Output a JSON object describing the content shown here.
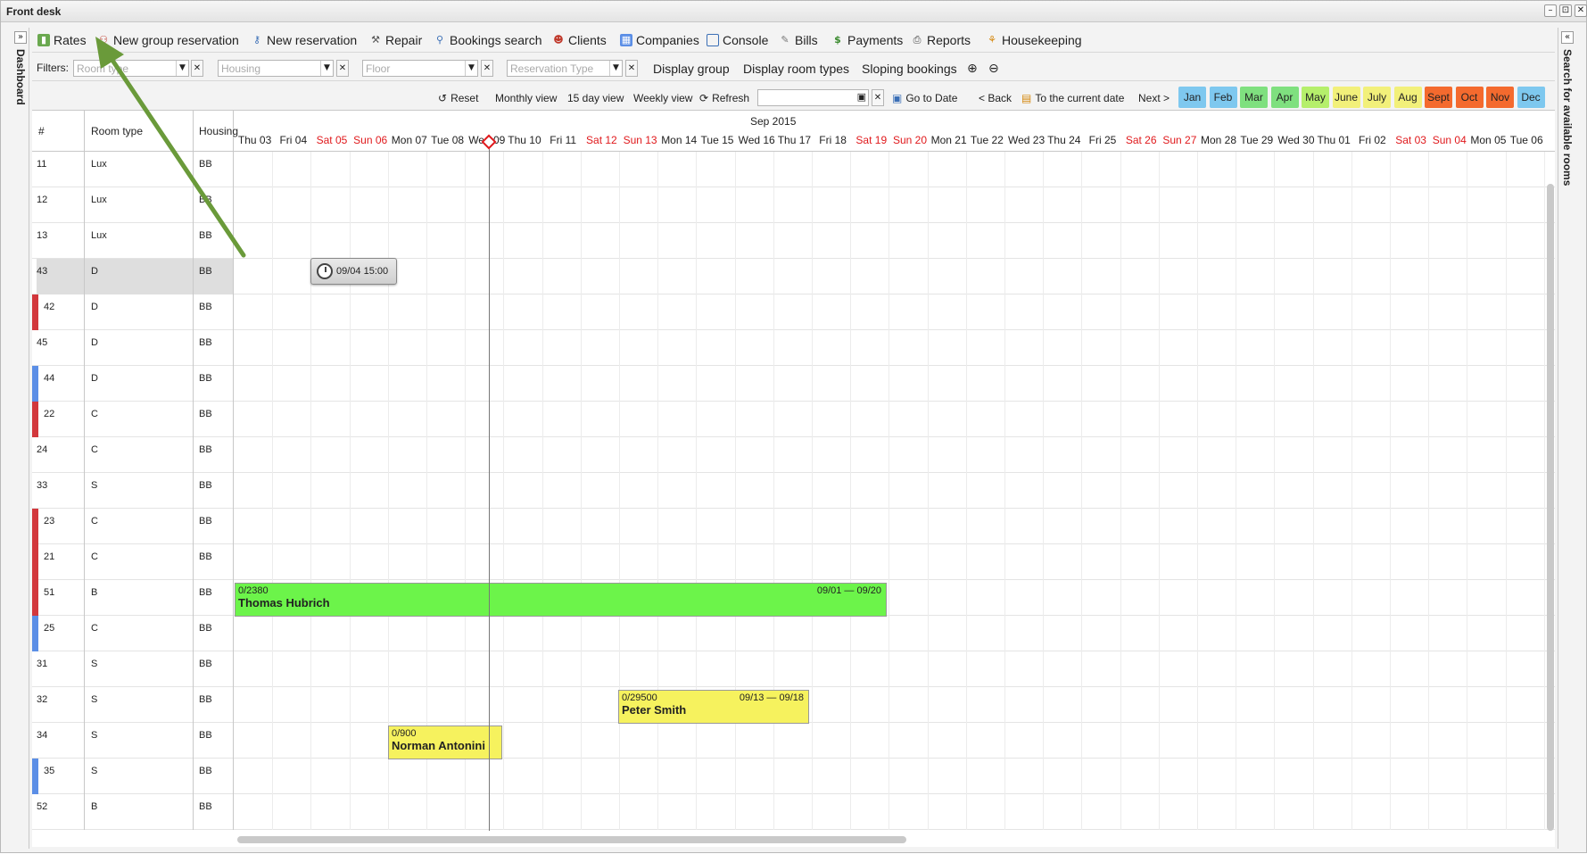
{
  "window": {
    "title": "Front desk",
    "controls": [
      "–",
      "⊡",
      "✕"
    ]
  },
  "sidebars": {
    "left_label": "Dashboard",
    "right_label": "Search for available rooms",
    "left_toggle": "»",
    "right_toggle": "«"
  },
  "menu": [
    {
      "label": "Rates",
      "icon": "bar-chart-icon"
    },
    {
      "label": "New group reservation",
      "icon": "group-icon"
    },
    {
      "label": "New reservation",
      "icon": "key-icon"
    },
    {
      "label": "Repair",
      "icon": "wrench-icon"
    },
    {
      "label": "Bookings search",
      "icon": "search-icon"
    },
    {
      "label": "Clients",
      "icon": "users-icon"
    },
    {
      "label": "Companies",
      "icon": "building-icon"
    },
    {
      "label": "Console",
      "icon": "window-icon"
    },
    {
      "label": "Bills",
      "icon": "notepad-icon"
    },
    {
      "label": "Payments",
      "icon": "dollar-icon"
    },
    {
      "label": "Reports",
      "icon": "printer-icon"
    },
    {
      "label": "Housekeeping",
      "icon": "broom-icon"
    }
  ],
  "filters": {
    "label": "Filters:",
    "room_type_placeholder": "Room type",
    "housing_placeholder": "Housing",
    "floor_placeholder": "Floor",
    "reservation_type_placeholder": "Reservation Type",
    "display_group": "Display group",
    "display_room_types": "Display room types",
    "sloping_bookings": "Sloping bookings"
  },
  "nav": {
    "reset": "Reset",
    "monthly": "Monthly view",
    "fifteen": "15 day view",
    "weekly": "Weekly view",
    "refresh": "Refresh",
    "go_to_date": "Go to Date",
    "back": "< Back",
    "current_date": "To the current date",
    "next": "Next >",
    "months": [
      {
        "label": "Jan",
        "color": "#7ec8ef"
      },
      {
        "label": "Feb",
        "color": "#7ec8ef"
      },
      {
        "label": "Mar",
        "color": "#7fe07f"
      },
      {
        "label": "Apr",
        "color": "#7fe07f"
      },
      {
        "label": "May",
        "color": "#b5ef6b"
      },
      {
        "label": "June",
        "color": "#f2f07a"
      },
      {
        "label": "July",
        "color": "#f2f07a"
      },
      {
        "label": "Aug",
        "color": "#f2f07a"
      },
      {
        "label": "Sept",
        "color": "#f46a2e"
      },
      {
        "label": "Oct",
        "color": "#f46a2e"
      },
      {
        "label": "Nov",
        "color": "#f46a2e"
      },
      {
        "label": "Dec",
        "color": "#7ec8ef"
      }
    ]
  },
  "grid": {
    "headers": {
      "num": "#",
      "room_type": "Room type",
      "housing": "Housing"
    },
    "month_label": "Sep 2015",
    "days": [
      {
        "label": "Thu 03",
        "weekend": false
      },
      {
        "label": "Fri 04",
        "weekend": false
      },
      {
        "label": "Sat 05",
        "weekend": true
      },
      {
        "label": "Sun 06",
        "weekend": true
      },
      {
        "label": "Mon 07",
        "weekend": false
      },
      {
        "label": "Tue 08",
        "weekend": false
      },
      {
        "label": "Wed 09",
        "weekend": false
      },
      {
        "label": "Thu 10",
        "weekend": false
      },
      {
        "label": "Fri 11",
        "weekend": false
      },
      {
        "label": "Sat 12",
        "weekend": true
      },
      {
        "label": "Sun 13",
        "weekend": true
      },
      {
        "label": "Mon 14",
        "weekend": false
      },
      {
        "label": "Tue 15",
        "weekend": false
      },
      {
        "label": "Wed 16",
        "weekend": false
      },
      {
        "label": "Thu 17",
        "weekend": false
      },
      {
        "label": "Fri 18",
        "weekend": false
      },
      {
        "label": "Sat 19",
        "weekend": true
      },
      {
        "label": "Sun 20",
        "weekend": true
      },
      {
        "label": "Mon 21",
        "weekend": false
      },
      {
        "label": "Tue 22",
        "weekend": false
      },
      {
        "label": "Wed 23",
        "weekend": false
      },
      {
        "label": "Thu 24",
        "weekend": false
      },
      {
        "label": "Fri 25",
        "weekend": false
      },
      {
        "label": "Sat 26",
        "weekend": true
      },
      {
        "label": "Sun 27",
        "weekend": true
      },
      {
        "label": "Mon 28",
        "weekend": false
      },
      {
        "label": "Tue 29",
        "weekend": false
      },
      {
        "label": "Wed 30",
        "weekend": false
      },
      {
        "label": "Thu 01",
        "weekend": false
      },
      {
        "label": "Fri 02",
        "weekend": false
      },
      {
        "label": "Sat 03",
        "weekend": true
      },
      {
        "label": "Sun 04",
        "weekend": true
      },
      {
        "label": "Mon 05",
        "weekend": false
      },
      {
        "label": "Tue 06",
        "weekend": false
      },
      {
        "label": "We",
        "weekend": false
      }
    ],
    "rooms": [
      {
        "num": "11",
        "type": "Lux",
        "housing": "BB",
        "marker": ""
      },
      {
        "num": "12",
        "type": "Lux",
        "housing": "BB",
        "marker": ""
      },
      {
        "num": "13",
        "type": "Lux",
        "housing": "BB",
        "marker": ""
      },
      {
        "num": "43",
        "type": "D",
        "housing": "BB",
        "marker": "",
        "highlight": true
      },
      {
        "num": "42",
        "type": "D",
        "housing": "BB",
        "marker": "#d2373c"
      },
      {
        "num": "45",
        "type": "D",
        "housing": "BB",
        "marker": ""
      },
      {
        "num": "44",
        "type": "D",
        "housing": "BB",
        "marker": "#5b8ee6"
      },
      {
        "num": "22",
        "type": "C",
        "housing": "BB",
        "marker": "#d2373c"
      },
      {
        "num": "24",
        "type": "C",
        "housing": "BB",
        "marker": ""
      },
      {
        "num": "33",
        "type": "S",
        "housing": "BB",
        "marker": ""
      },
      {
        "num": "23",
        "type": "C",
        "housing": "BB",
        "marker": "#d2373c"
      },
      {
        "num": "21",
        "type": "C",
        "housing": "BB",
        "marker": "#d2373c"
      },
      {
        "num": "51",
        "type": "B",
        "housing": "BB",
        "marker": "#d2373c"
      },
      {
        "num": "25",
        "type": "C",
        "housing": "BB",
        "marker": "#5b8ee6"
      },
      {
        "num": "31",
        "type": "S",
        "housing": "BB",
        "marker": ""
      },
      {
        "num": "32",
        "type": "S",
        "housing": "BB",
        "marker": ""
      },
      {
        "num": "34",
        "type": "S",
        "housing": "BB",
        "marker": ""
      },
      {
        "num": "35",
        "type": "S",
        "housing": "BB",
        "marker": "#5b8ee6"
      },
      {
        "num": "52",
        "type": "B",
        "housing": "BB",
        "marker": ""
      }
    ]
  },
  "bookings": [
    {
      "code": "0/2380",
      "name": "Thomas Hubrich",
      "range": "09/01 — 09/20",
      "color": "#6cf44a"
    },
    {
      "code": "0/29500",
      "name": "Peter Smith",
      "range": "09/13 — 09/18",
      "color": "#f6f25e"
    },
    {
      "code": "0/900",
      "name": "Norman Antonini",
      "range": "",
      "color": "#f6f25e"
    }
  ],
  "tooltip": {
    "text": "09/04 15:00"
  },
  "colors": {
    "annotation_arrow": "#6a9a3a",
    "weekend": "#e0191c"
  }
}
